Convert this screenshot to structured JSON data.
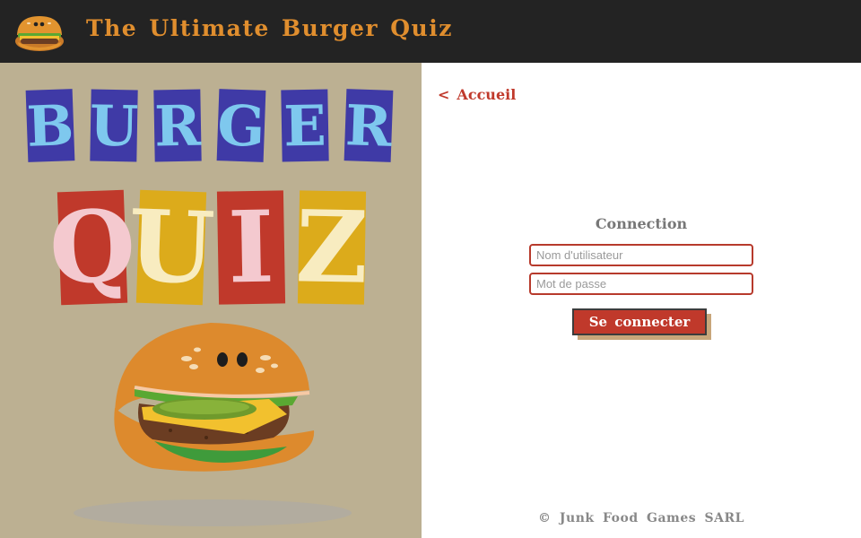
{
  "header": {
    "title": "The Ultimate Burger Quiz",
    "logo_icon": "burger-icon"
  },
  "hero": {
    "word1": [
      "B",
      "U",
      "R",
      "G",
      "E",
      "R"
    ],
    "word2": [
      "Q",
      "U",
      "I",
      "Z"
    ],
    "word1_colors": {
      "tile": "#3f3aa6",
      "letter": "#7ec8ee"
    },
    "word2_tiles": [
      "#c0392b",
      "#dcab1b",
      "#c0392b",
      "#dcab1b"
    ],
    "word2_letters": [
      "#f4c9cf",
      "#f8ecc0",
      "#f4c9cf",
      "#f8ecc0"
    ],
    "mascot_icon": "burger-mascot-icon"
  },
  "nav": {
    "back_label": "Accueil",
    "back_icon": "chevron-left-icon"
  },
  "login": {
    "title": "Connection",
    "username_placeholder": "Nom d'utilisateur",
    "password_placeholder": "Mot de passe",
    "submit_label": "Se connecter"
  },
  "footer": {
    "text": "© Junk Food Games SARL"
  },
  "colors": {
    "header_bg": "#232323",
    "brand_orange": "#e08e2e",
    "accent_red": "#c0392b",
    "panel_bg": "#bcb092"
  }
}
